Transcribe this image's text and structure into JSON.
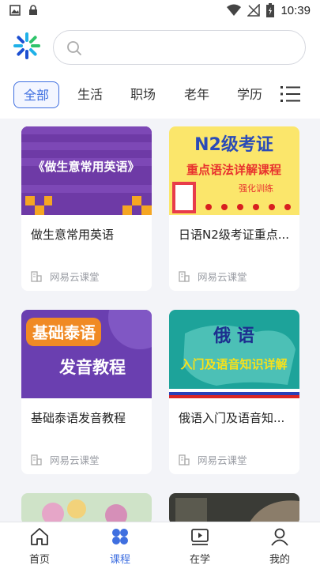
{
  "status": {
    "time": "10:39"
  },
  "search": {
    "placeholder": ""
  },
  "tabs": [
    {
      "label": "全部",
      "active": true
    },
    {
      "label": "生活"
    },
    {
      "label": "职场"
    },
    {
      "label": "老年"
    },
    {
      "label": "学历"
    }
  ],
  "courses": [
    {
      "thumb_text": "《做生意常用英语》",
      "title": "做生意常用英语",
      "source": "网易云课堂"
    },
    {
      "thumb_text_1": "N2级考证",
      "thumb_text_2": "重点语法详解课程",
      "thumb_text_3": "强化训练",
      "title": "日语N2级考证重点...",
      "source": "网易云课堂"
    },
    {
      "thumb_text_1": "基础泰语",
      "thumb_text_2": "发音教程",
      "title": "基础泰语发音教程",
      "source": "网易云课堂"
    },
    {
      "thumb_text_1": "俄 语",
      "thumb_text_2": "入门及语音知识详解",
      "title": "俄语入门及语音知...",
      "source": "网易云课堂"
    }
  ],
  "nav": [
    {
      "label": "首页",
      "icon": "home-icon"
    },
    {
      "label": "课程",
      "icon": "courses-icon",
      "active": true
    },
    {
      "label": "在学",
      "icon": "learning-icon"
    },
    {
      "label": "我的",
      "icon": "profile-icon"
    }
  ],
  "colors": {
    "accent": "#3f6fe0"
  }
}
